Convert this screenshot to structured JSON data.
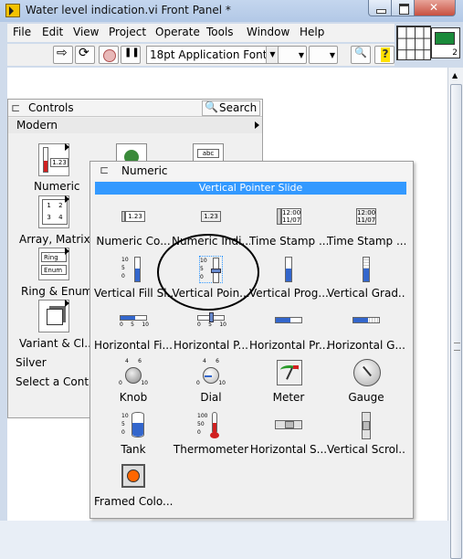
{
  "window": {
    "title": "Water level indication.vi Front Panel *"
  },
  "menubar": {
    "items": [
      "File",
      "Edit",
      "View",
      "Project",
      "Operate",
      "Tools",
      "Window",
      "Help"
    ]
  },
  "toolbar": {
    "font_selector": "18pt Application Font"
  },
  "vi_icon": {
    "number": "2"
  },
  "controls_palette": {
    "title": "Controls",
    "search_label": "Search",
    "category": "Modern",
    "items": [
      {
        "label": "Numeric",
        "icon_text": "1.23"
      },
      {
        "label": "Array, Matrix...",
        "icon_text": "1 2 3 4"
      },
      {
        "label": "Ring & Enum",
        "icon_text": "Ring"
      },
      {
        "label": "Variant & Cl...",
        "icon_text": ""
      }
    ],
    "enum_icon_text": "Enum",
    "boolean_icon_text": "abc",
    "silver_label": "Silver",
    "select_control_label": "Select a Control..."
  },
  "numeric_palette": {
    "title": "Numeric",
    "selected_item": "Vertical Pointer Slide",
    "items": [
      {
        "label": "Numeric Co...",
        "icon": "numeric-control-icon",
        "icon_text": "1.23"
      },
      {
        "label": "Numeric Indi...",
        "icon": "numeric-indicator-icon",
        "icon_text": "1.23"
      },
      {
        "label": "Time Stamp ...",
        "icon": "timestamp-control-icon",
        "icon_text": "12:00 11/07"
      },
      {
        "label": "Time Stamp ...",
        "icon": "timestamp-indicator-icon",
        "icon_text": "12:00 11/07"
      },
      {
        "label": "Vertical Fill Sl...",
        "icon": "vertical-fill-slide-icon"
      },
      {
        "label": "Vertical Poin...",
        "icon": "vertical-pointer-slide-icon"
      },
      {
        "label": "Vertical Prog...",
        "icon": "vertical-progress-bar-icon"
      },
      {
        "label": "Vertical Grad...",
        "icon": "vertical-graduated-bar-icon"
      },
      {
        "label": "Horizontal Fi...",
        "icon": "horizontal-fill-slide-icon"
      },
      {
        "label": "Horizontal P...",
        "icon": "horizontal-pointer-slide-icon"
      },
      {
        "label": "Horizontal Pr...",
        "icon": "horizontal-progress-bar-icon"
      },
      {
        "label": "Horizontal G...",
        "icon": "horizontal-graduated-bar-icon"
      },
      {
        "label": "Knob",
        "icon": "knob-icon"
      },
      {
        "label": "Dial",
        "icon": "dial-icon"
      },
      {
        "label": "Meter",
        "icon": "meter-icon"
      },
      {
        "label": "Gauge",
        "icon": "gauge-icon"
      },
      {
        "label": "Tank",
        "icon": "tank-icon"
      },
      {
        "label": "Thermometer",
        "icon": "thermometer-icon"
      },
      {
        "label": "Horizontal S...",
        "icon": "horizontal-scrollbar-icon"
      },
      {
        "label": "Vertical Scrol...",
        "icon": "vertical-scrollbar-icon"
      },
      {
        "label": "Framed Colo...",
        "icon": "framed-color-box-icon"
      }
    ],
    "scale_ticks": [
      "10",
      "5",
      "0"
    ],
    "horizontal_scale_ticks": [
      "0",
      "5",
      "10"
    ],
    "knob_ticks": [
      "4",
      "6",
      "2",
      "8",
      "0",
      "10"
    ],
    "dial_ticks": [
      "4",
      "6",
      "2",
      "8",
      "0",
      "10"
    ],
    "tank_ticks": [
      "10",
      "5",
      "0"
    ],
    "thermometer_ticks": [
      "100",
      "50",
      "0"
    ]
  },
  "colors": {
    "selection": "#3399ff",
    "tank_fill": "#3366cc",
    "color_box": "#ff6600"
  }
}
